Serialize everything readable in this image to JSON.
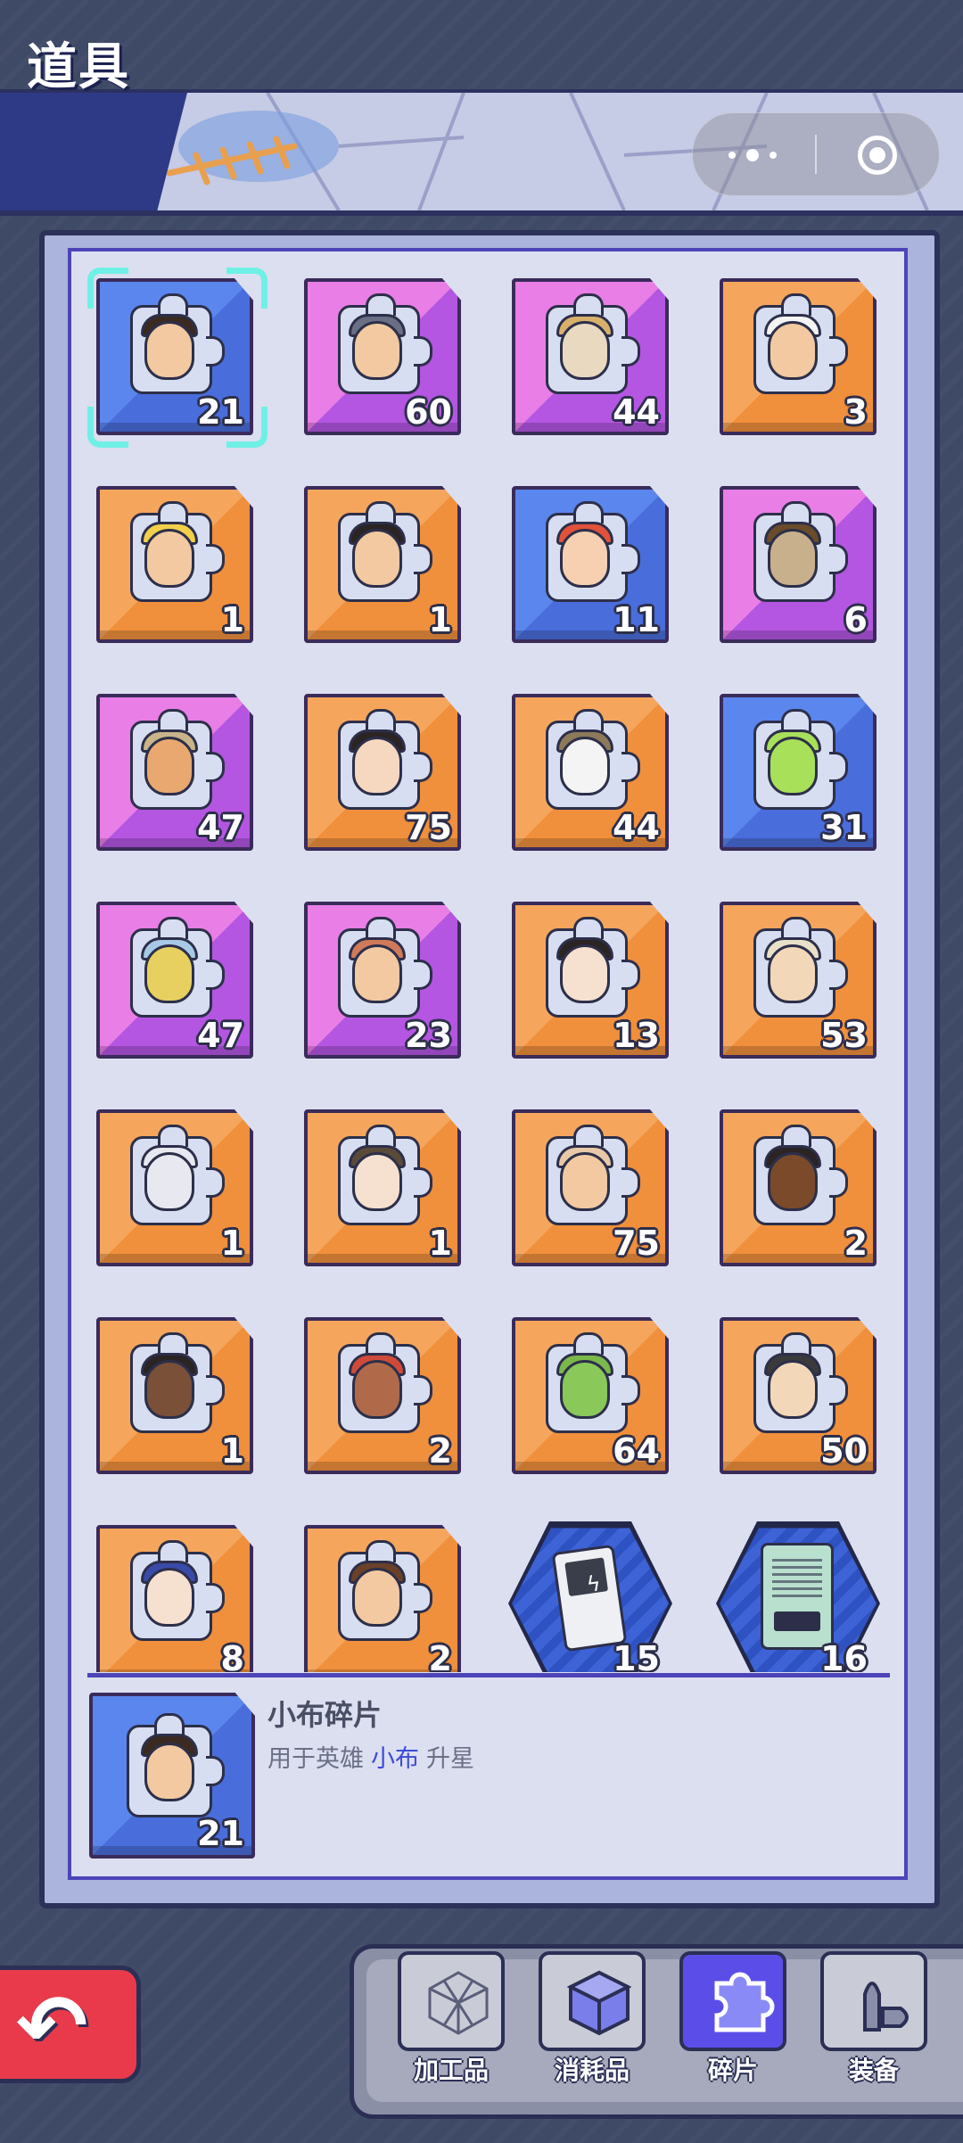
{
  "header": {
    "title": "道具"
  },
  "grid": {
    "items": [
      {
        "count": "21",
        "rarity": "blue",
        "hair": "#3a2a22",
        "skin": "#f2c9a0",
        "selected": true
      },
      {
        "count": "60",
        "rarity": "purple",
        "hair": "#6b6f86",
        "skin": "#f2c9a0"
      },
      {
        "count": "44",
        "rarity": "purple",
        "hair": "#d8b06a",
        "skin": "#e8d9c0"
      },
      {
        "count": "3",
        "rarity": "orange",
        "hair": "#f4f4f4",
        "skin": "#f2c9a0"
      },
      {
        "count": "1",
        "rarity": "orange",
        "hair": "#f2d04a",
        "skin": "#f2c9a0"
      },
      {
        "count": "1",
        "rarity": "orange",
        "hair": "#2a2424",
        "skin": "#f2c9a0"
      },
      {
        "count": "11",
        "rarity": "blue",
        "hair": "#e0523a",
        "skin": "#f6d0b0"
      },
      {
        "count": "6",
        "rarity": "purple",
        "hair": "#6a4b2a",
        "skin": "#c8b08c"
      },
      {
        "count": "47",
        "rarity": "purple",
        "hair": "#c9b48a",
        "skin": "#e8a870"
      },
      {
        "count": "75",
        "rarity": "orange",
        "hair": "#2a2424",
        "skin": "#f6d8c0"
      },
      {
        "count": "44",
        "rarity": "orange",
        "hair": "#8c7a5a",
        "skin": "#f4f4f4"
      },
      {
        "count": "31",
        "rarity": "blue",
        "hair": "#a8e05a",
        "skin": "#a8e05a"
      },
      {
        "count": "47",
        "rarity": "purple",
        "hair": "#a8c8e8",
        "skin": "#e8d060"
      },
      {
        "count": "23",
        "rarity": "purple",
        "hair": "#d07a5a",
        "skin": "#f2c9a0"
      },
      {
        "count": "13",
        "rarity": "orange",
        "hair": "#2a2424",
        "skin": "#f6e0d0"
      },
      {
        "count": "53",
        "rarity": "orange",
        "hair": "#e8e0c8",
        "skin": "#f2d8b8"
      },
      {
        "count": "1",
        "rarity": "orange",
        "hair": "#e8e8f0",
        "skin": "#e8e8f0"
      },
      {
        "count": "1",
        "rarity": "orange",
        "hair": "#5a4a3a",
        "skin": "#f6e0d0"
      },
      {
        "count": "75",
        "rarity": "orange",
        "hair": "#e8c8a8",
        "skin": "#f2c9a0"
      },
      {
        "count": "2",
        "rarity": "orange",
        "hair": "#2a2424",
        "skin": "#7a4a2a"
      },
      {
        "count": "1",
        "rarity": "orange",
        "hair": "#2a2424",
        "skin": "#7a5038"
      },
      {
        "count": "2",
        "rarity": "orange",
        "hair": "#d04a3a",
        "skin": "#b06a4a"
      },
      {
        "count": "64",
        "rarity": "orange",
        "hair": "#7ab84a",
        "skin": "#8ac85a"
      },
      {
        "count": "50",
        "rarity": "orange",
        "hair": "#3a3a3a",
        "skin": "#f2d8b8"
      },
      {
        "count": "8",
        "rarity": "orange",
        "hair": "#3a4aa8",
        "skin": "#f6e0d0"
      },
      {
        "count": "2",
        "rarity": "orange",
        "hair": "#6a4028",
        "skin": "#f2c9a0"
      },
      {
        "count": "15",
        "rarity": "hex",
        "icon": "gameboy-icon"
      },
      {
        "count": "16",
        "rarity": "hex",
        "icon": "recorder-icon"
      }
    ]
  },
  "detail": {
    "name": "小布碎片",
    "desc_prefix": "用于英雄",
    "hero": "小布",
    "desc_suffix": "升星",
    "count": "21"
  },
  "tabs": [
    {
      "label": "加工品",
      "icon": "wireframe-cube-icon",
      "active": false
    },
    {
      "label": "消耗品",
      "icon": "box-icon",
      "active": false
    },
    {
      "label": "碎片",
      "icon": "puzzle-piece-icon",
      "active": true
    },
    {
      "label": "装备",
      "icon": "bullet-icon",
      "active": false
    }
  ],
  "colors": {
    "orange": "#f08f3c",
    "purple": "#b456e2",
    "blue": "#4a6ddc",
    "selected_frame": "#6ff0e4",
    "tab_active": "#5b4ee8",
    "back": "#e83a4a"
  }
}
